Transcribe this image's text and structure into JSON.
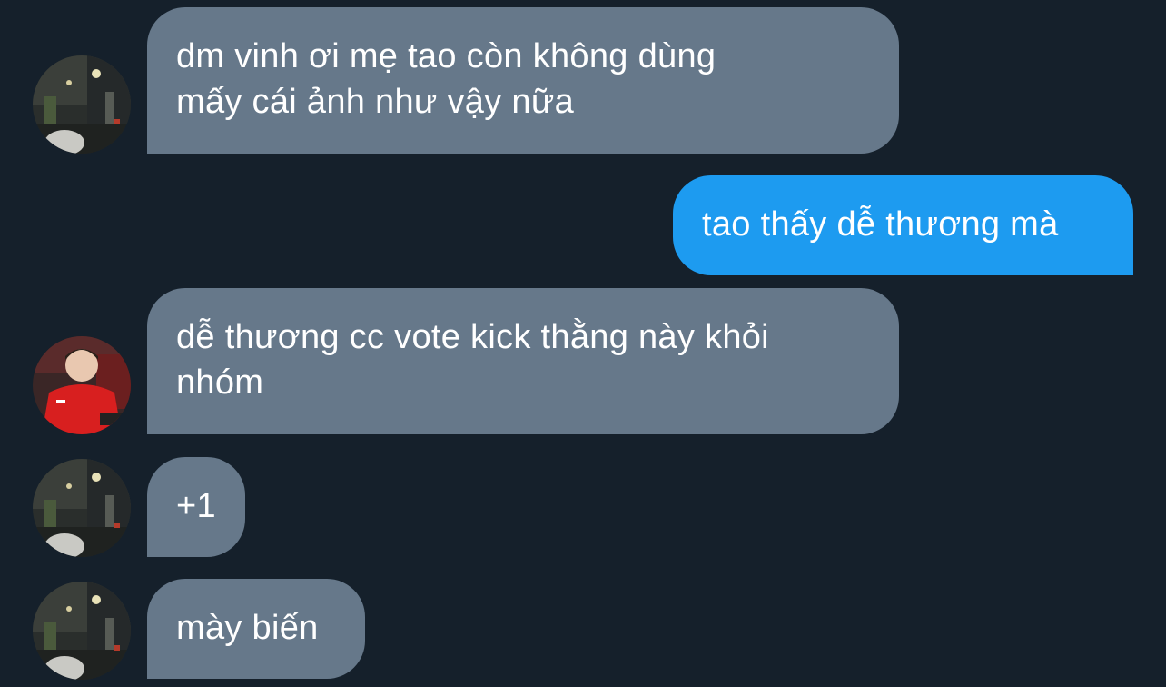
{
  "conversation": {
    "messages": [
      {
        "direction": "incoming",
        "sender_avatar": "avatar-night-street",
        "text": "dm vinh ơi mẹ tao còn không dùng\nmấy cái ảnh như vậy nữa"
      },
      {
        "direction": "outgoing",
        "text": "tao thấy dễ thương mà"
      },
      {
        "direction": "incoming",
        "sender_avatar": "avatar-red-jacket",
        "text": "dễ thương cc vote kick thằng này khỏi\nnhóm"
      },
      {
        "direction": "incoming",
        "sender_avatar": "avatar-night-street",
        "text": "+1"
      },
      {
        "direction": "incoming",
        "sender_avatar": "avatar-night-street",
        "text": "mày biến"
      }
    ]
  },
  "colors": {
    "background": "#15202b",
    "incoming_bubble": "#66788a",
    "outgoing_bubble": "#1d9bf0",
    "text": "#ffffff"
  }
}
